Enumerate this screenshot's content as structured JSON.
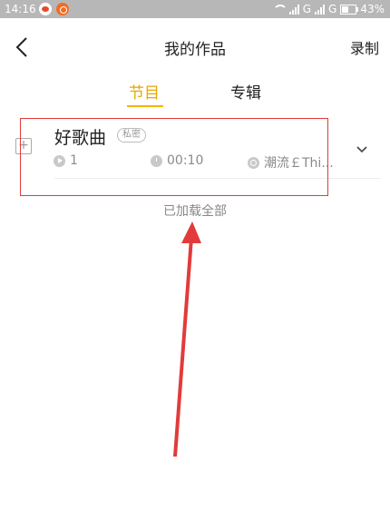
{
  "status_bar": {
    "time": "14:16",
    "network_1": "G",
    "network_2": "G",
    "battery_percent": "43%",
    "icons": [
      "weibo-icon",
      "app-notification-icon",
      "wifi-icon",
      "signal-icon",
      "battery-icon"
    ]
  },
  "header": {
    "title": "我的作品",
    "record_label": "录制",
    "back_icon": "chevron-left-icon"
  },
  "tabs": [
    {
      "label": "节目",
      "active": true
    },
    {
      "label": "专辑",
      "active": false
    }
  ],
  "item": {
    "title": "好歌曲",
    "badge": "私密",
    "plays": "1",
    "duration": "00:10",
    "category": "潮流￡Thi..."
  },
  "list_footer": "已加载全部",
  "colors": {
    "accent": "#f5b400",
    "annotation": "#e23b3b",
    "status_bar": "#b7b7b7"
  }
}
